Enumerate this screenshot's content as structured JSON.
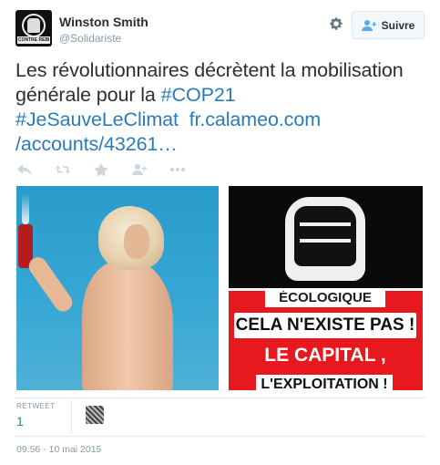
{
  "header": {
    "avatar_text": "CONTRE REBELLION",
    "name": "Winston Smith",
    "handle": "@Solidariste",
    "follow_label": "Suivre",
    "gear_icon": "gear-icon",
    "follow_icon": "add-user-icon"
  },
  "tweet": {
    "text_plain_1": "Les révolutionnaires décrètent la mobilisation générale pour la ",
    "hashtag_cop21": "#COP21",
    "hashtag_climat": "#JeSauveLeClimat",
    "link_1": "fr.calameo.com",
    "link_2": "/accounts/43261…"
  },
  "actions": [
    {
      "name": "reply-icon"
    },
    {
      "name": "retweet-icon"
    },
    {
      "name": "favorite-icon"
    },
    {
      "name": "follow-icon"
    },
    {
      "name": "more-icon"
    }
  ],
  "media": {
    "poster_lines": [
      "ÉCOLOGIQUE",
      "CELA N'EXISTE PAS !",
      "LE CAPITAL , C'EST",
      "L'EXPLOITATION !"
    ]
  },
  "stats": {
    "retweet_label": "RETWEET",
    "retweet_count": "1"
  },
  "timestamp": "09:56 - 10 mai 2015",
  "colors": {
    "link": "#2b7bb9",
    "text": "#292f33",
    "muted": "#8899a6",
    "poster_red": "#e8181f"
  }
}
